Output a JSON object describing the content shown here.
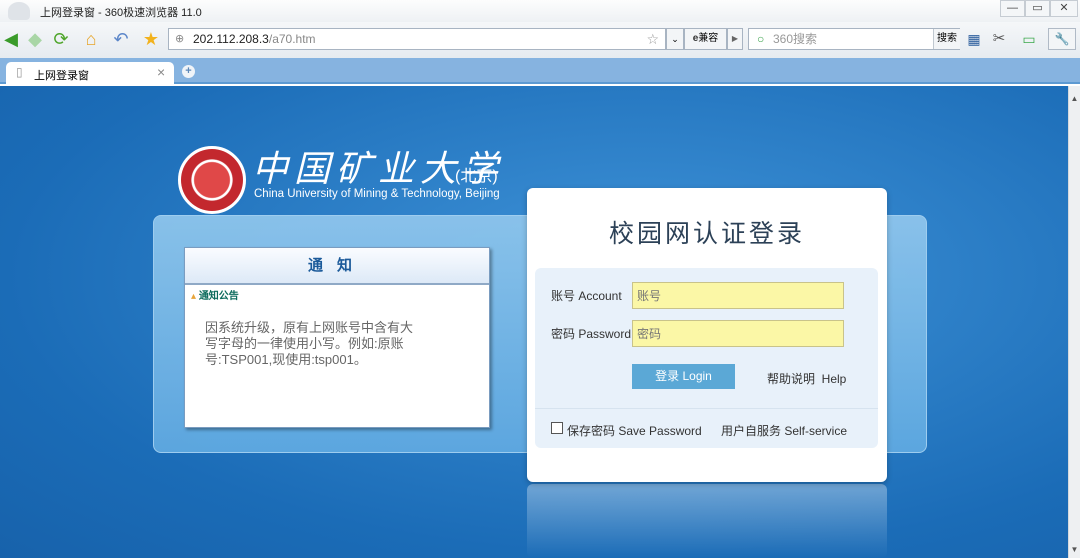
{
  "window": {
    "title": "上网登录窗 - 360极速浏览器 11.0",
    "minimize": "—",
    "restore": "▭",
    "close": "✕"
  },
  "toolbar": {
    "address_host": "202.112.208.3",
    "address_path": "/a70.htm",
    "compat_label": "兼容",
    "search_placeholder": "360搜索",
    "search_button": "搜索"
  },
  "tabs": [
    {
      "label": "上网登录窗",
      "close": "×"
    }
  ],
  "logo": {
    "chinese": "中国矿业大学",
    "campus": "(北京)",
    "english": "China University of Mining & Technology, Beijing"
  },
  "notice": {
    "title": "通知",
    "subtitle": "通知公告",
    "body": "因系统升级，原有上网账号中含有大写字母的一律使用小写。例如:原账号:TSP001,现使用:tsp001。"
  },
  "login": {
    "title": "校园网认证登录",
    "account_label": "账号 Account",
    "account_placeholder": "账号",
    "password_label": "密码 Password",
    "password_placeholder": "密码",
    "login_button": "登录 Login",
    "help_link": "帮助说明  Help",
    "save_password": "保存密码 Save Password",
    "self_service": "用户自服务 Self-service"
  }
}
